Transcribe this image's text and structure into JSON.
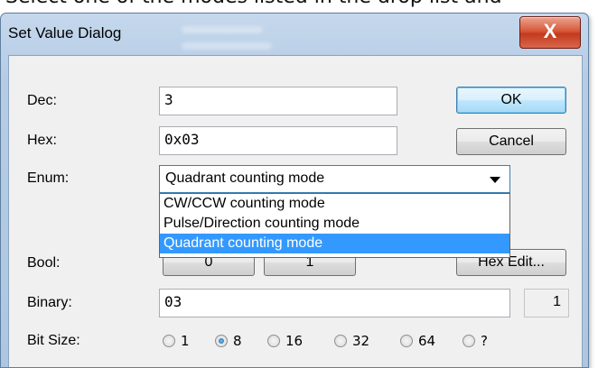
{
  "background_text": "Select one of the modes listed in the drop list and",
  "dialog": {
    "title": "Set Value Dialog",
    "close_glyph": "X",
    "fields": {
      "dec_label": "Dec:",
      "dec_value": "3",
      "hex_label": "Hex:",
      "hex_value": "0x03",
      "enum_label": "Enum:",
      "enum_selected": "Quadrant counting mode",
      "bool_label": "Bool:",
      "bool_false": "0",
      "bool_true": "1",
      "binary_label": "Binary:",
      "binary_value": "03",
      "binary_count": "1",
      "bitsize_label": "Bit Size:"
    },
    "buttons": {
      "ok": "OK",
      "cancel": "Cancel",
      "hex_edit": "Hex Edit..."
    },
    "enum_options": [
      {
        "label": "CW/CCW counting mode",
        "selected": false
      },
      {
        "label": "Pulse/Direction counting mode",
        "selected": false
      },
      {
        "label": "Quadrant counting mode",
        "selected": true
      }
    ],
    "bit_sizes": [
      {
        "label": "1",
        "checked": false
      },
      {
        "label": "8",
        "checked": true
      },
      {
        "label": "16",
        "checked": false
      },
      {
        "label": "32",
        "checked": false
      },
      {
        "label": "64",
        "checked": false
      },
      {
        "label": "?",
        "checked": false
      }
    ]
  },
  "colors": {
    "selection": "#3399ff",
    "close_button": "#c33b1e",
    "default_button_border": "#3c7fb1"
  }
}
